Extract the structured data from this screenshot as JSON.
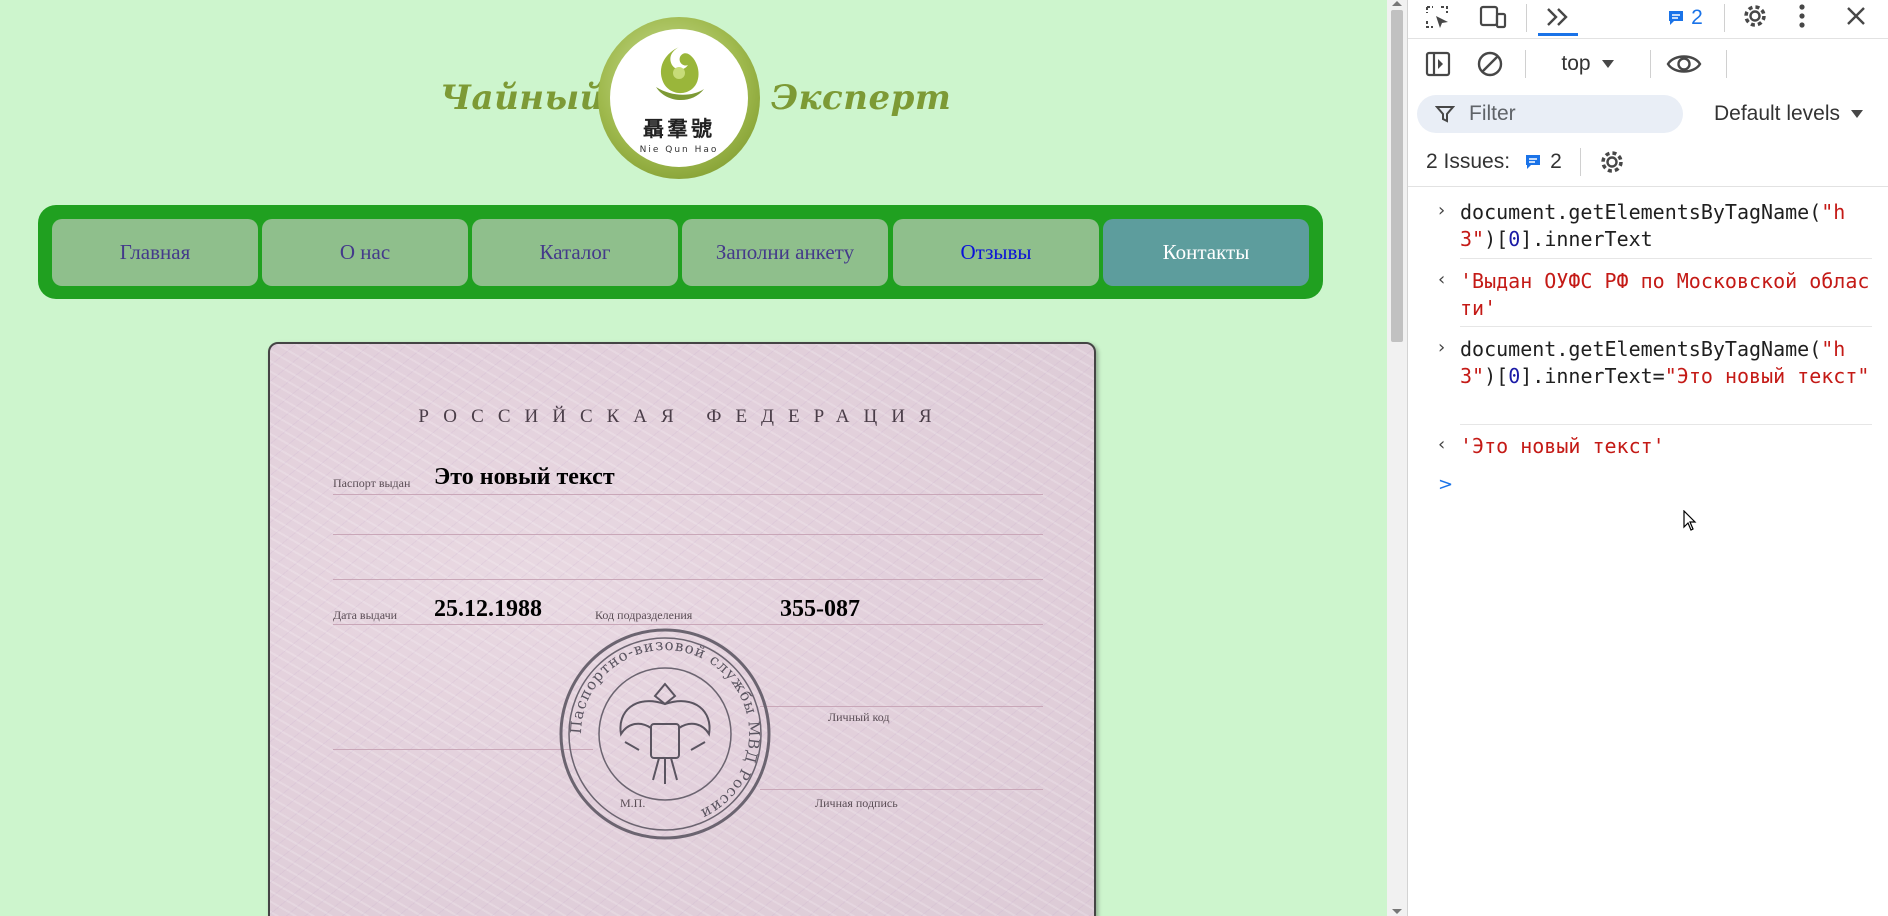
{
  "site": {
    "logo_left": "Чайный",
    "logo_right": "Эксперт",
    "logo_chars": "聶羣號",
    "logo_subtitle": "Nie Qun Hao",
    "nav": [
      {
        "label": "Главная"
      },
      {
        "label": "О нас"
      },
      {
        "label": "Каталог"
      },
      {
        "label": "Заполни анкету"
      },
      {
        "label": "Отзывы"
      },
      {
        "label": "Контакты"
      }
    ],
    "passport": {
      "header": "РОССИЙСКАЯ ФЕДЕРАЦИЯ",
      "issued_by_label": "Паспорт выдан",
      "issued_by_value": "Это новый текст",
      "date_label": "Дата выдачи",
      "date_value": "25.12.1988",
      "code_label": "Код подразделения",
      "code_value": "355-087",
      "personal_code_label": "Личный код",
      "mp_label": "М.П.",
      "signature_label": "Личная подпись",
      "stamp_text": "Паспортно-визовой службы МВД России"
    }
  },
  "devtools": {
    "issues_badge_count": "2",
    "context_selector": "top",
    "filter_placeholder": "Filter",
    "levels_label": "Default levels",
    "issues_label": "2 Issues:",
    "issues_count": "2",
    "console": [
      {
        "type": "input",
        "text_parts": [
          "document.getElementsByTagName(",
          "\"h3\"",
          ")[",
          "0",
          "].innerText"
        ]
      },
      {
        "type": "output",
        "text": "'Выдан ОУФС РФ по Московской области'"
      },
      {
        "type": "input",
        "text_parts": [
          "document.getElementsByTagName(",
          "\"h3\"",
          ")[",
          "0",
          "].innerText=",
          "\"Это новый текст\""
        ]
      },
      {
        "type": "output",
        "text": "'Это новый текст'"
      }
    ],
    "prompt": ">"
  },
  "colors": {
    "page_bg": "#cdf5cd",
    "nav_bg": "#20a020",
    "nav_item": "#8fbf8c",
    "nav_active": "#5d9d9d",
    "logo_text": "#7d9a35",
    "console_string": "#c41a16",
    "accent_blue": "#1a73e8"
  }
}
